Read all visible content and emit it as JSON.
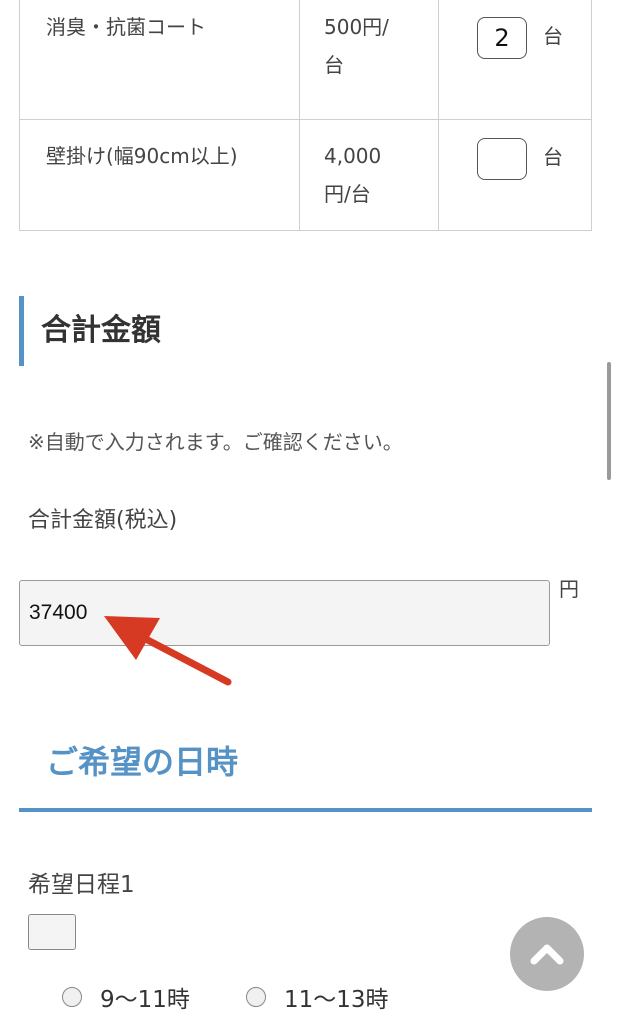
{
  "options": [
    {
      "name": "消臭・抗菌コート",
      "price_line1": "500円/",
      "price_line2": "台",
      "qty": "2",
      "unit": "台"
    },
    {
      "name": "壁掛け(幅90cm以上)",
      "price_line1": "4,000",
      "price_line2": "円/台",
      "qty": "",
      "unit": "台"
    }
  ],
  "total_section": {
    "heading": "合計金額",
    "note": "※自動で入力されます。ご確認ください。",
    "label": "合計金額(税込)",
    "value": "37400",
    "unit": "円"
  },
  "date_section": {
    "heading": "ご希望の日時",
    "pref_label": "希望日程1",
    "date_value": "",
    "time_options": [
      "9〜11時",
      "11〜13時"
    ]
  },
  "colors": {
    "accent": "#5592c5",
    "arrow": "#d63a22",
    "scroll_button": "#b3b3b3"
  },
  "icons": {
    "annotation": "red-arrow-icon",
    "scroll_top": "chevron-up-icon"
  }
}
